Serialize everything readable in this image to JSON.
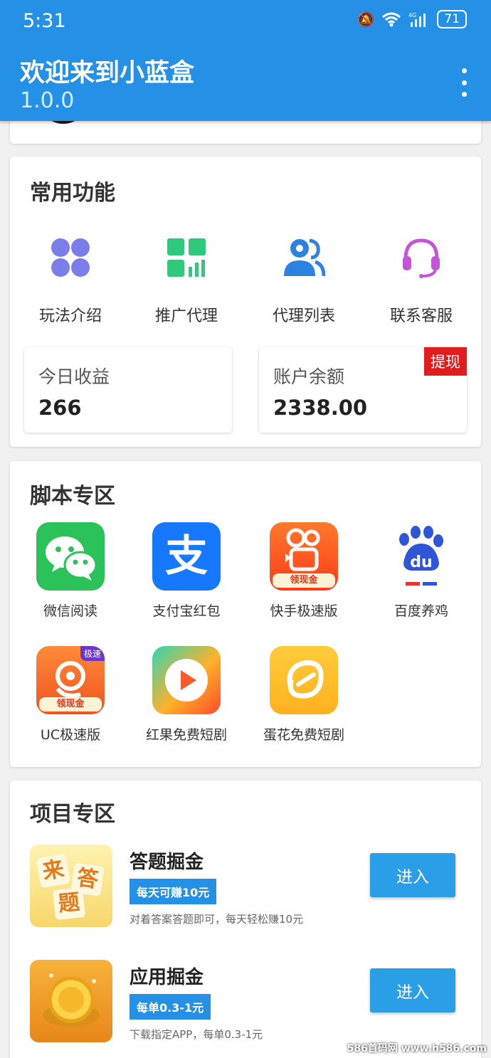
{
  "status_bar": {
    "time": "5:31",
    "battery": "71"
  },
  "header": {
    "title": "欢迎来到小蓝盒",
    "version": "1.0.0"
  },
  "common": {
    "title": "常用功能",
    "items": [
      {
        "label": "玩法介绍",
        "icon": "grid-dots-icon",
        "color": "#7b7ee8"
      },
      {
        "label": "推广代理",
        "icon": "dashboard-icon",
        "color": "#2ec97a"
      },
      {
        "label": "代理列表",
        "icon": "users-icon",
        "color": "#2d82e0"
      },
      {
        "label": "联系客服",
        "icon": "headset-icon",
        "color": "#c455d6"
      }
    ],
    "today_income": {
      "label": "今日收益",
      "value": "266"
    },
    "balance": {
      "label": "账户余额",
      "value": "2338.00",
      "withdraw": "提现"
    }
  },
  "scripts": {
    "title": "脚本专区",
    "items": [
      {
        "label": "微信阅读",
        "icon": "wechat-icon"
      },
      {
        "label": "支付宝红包",
        "icon": "alipay-icon",
        "glyph": "支"
      },
      {
        "label": "快手极速版",
        "icon": "kuaishou-icon",
        "tag": "领现金"
      },
      {
        "label": "百度养鸡",
        "icon": "baidu-icon",
        "glyph": "du"
      },
      {
        "label": "UC极速版",
        "icon": "uc-icon",
        "tag": "领现金",
        "badge": "极速"
      },
      {
        "label": "红果免费短剧",
        "icon": "hongguo-icon"
      },
      {
        "label": "蛋花免费短剧",
        "icon": "danhua-icon"
      }
    ]
  },
  "projects": {
    "title": "项目专区",
    "items": [
      {
        "name": "答题掘金",
        "tag": "每天可赚10元",
        "desc": "对着答案答题即可，每天轻松赚10元",
        "button": "进入",
        "icon": "quiz-icon",
        "glyphs": [
          "来",
          "答",
          "题"
        ]
      },
      {
        "name": "应用掘金",
        "tag": "每单0.3-1元",
        "desc": "下载指定APP，每单0.3-1元",
        "button": "进入",
        "icon": "gold-coin-icon"
      }
    ]
  },
  "watermark": "586首码网 www.h586.com"
}
